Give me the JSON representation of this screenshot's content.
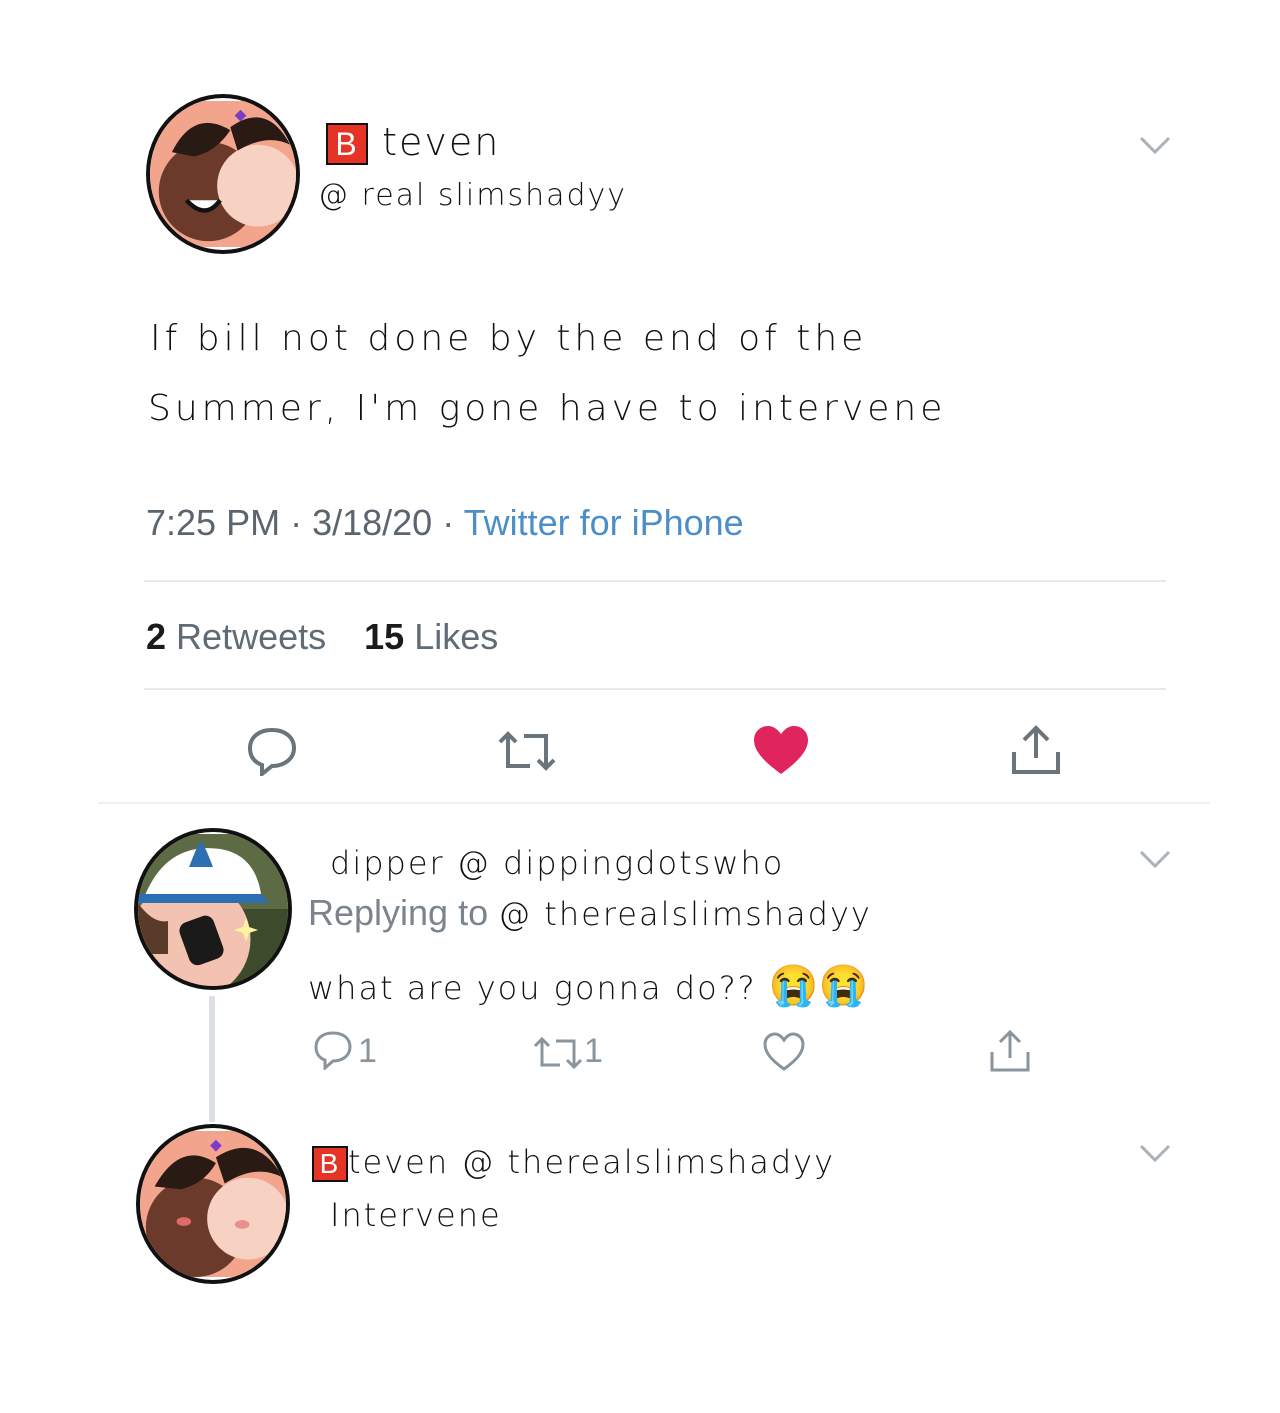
{
  "tweet": {
    "display_name_badge": "B",
    "display_name": "teven",
    "handle": "@ real slimshadyy",
    "text_line1": "If bill not done by the end of the",
    "text_line2": "Summer, I'm gone have to intervene",
    "time": "7:25 PM",
    "date": "3/18/20",
    "source": "Twitter for iPhone",
    "retweets_count": "2",
    "retweets_label": "Retweets",
    "likes_count": "15",
    "likes_label": "Likes",
    "liked": true
  },
  "reply1": {
    "display_name": "dipper",
    "handle": "@ dippingdotswho",
    "replying_label": "Replying to",
    "replying_handle": "@ therealslimshadyy",
    "text": "what are you gonna do??",
    "emoji": "😭😭",
    "reply_count": "1",
    "retweet_count": "1"
  },
  "reply2": {
    "display_name_badge": "B",
    "display_name": "teven",
    "handle": "@ therealslimshadyy",
    "text": "Intervene"
  },
  "colors": {
    "like_red": "#e0245e",
    "link_blue": "#4b8ec8",
    "meta_gray": "#5b6570",
    "badge_red": "#e53325"
  },
  "icons": [
    "chevron-down-icon",
    "reply-icon",
    "retweet-icon",
    "heart-icon",
    "share-icon"
  ]
}
